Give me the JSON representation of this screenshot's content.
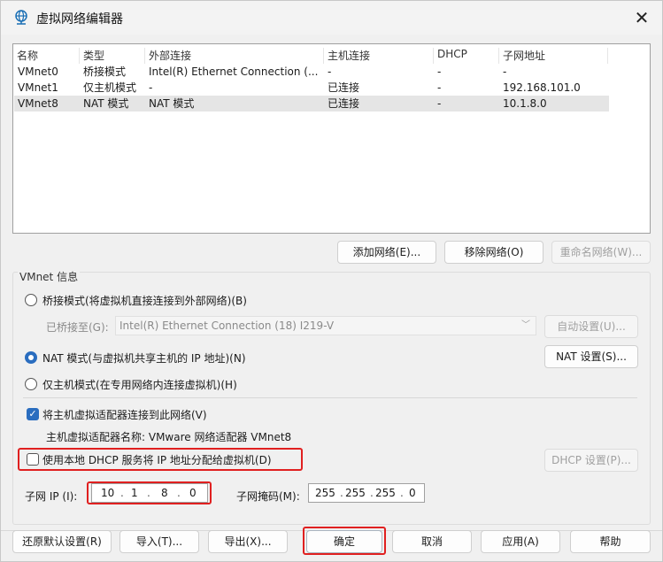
{
  "window": {
    "title": "虚拟网络编辑器",
    "close": "✕"
  },
  "table": {
    "headers": [
      "名称",
      "类型",
      "外部连接",
      "主机连接",
      "DHCP",
      "子网地址"
    ],
    "rows": [
      [
        "VMnet0",
        "桥接模式",
        "Intel(R) Ethernet Connection (...",
        "-",
        "-",
        "-"
      ],
      [
        "VMnet1",
        "仅主机模式",
        "-",
        "已连接",
        "-",
        "192.168.101.0"
      ],
      [
        "VMnet8",
        "NAT 模式",
        "NAT 模式",
        "已连接",
        "-",
        "10.1.8.0"
      ]
    ],
    "selected_row": 2
  },
  "list_buttons": {
    "add": "添加网络(E)...",
    "remove": "移除网络(O)",
    "rename": "重命名网络(W)..."
  },
  "vmnet_info": {
    "group_label": "VMnet 信息",
    "bridge_label": "桥接模式(将虚拟机直接连接到外部网络)(B)",
    "bridge_to_label": "已桥接至(G):",
    "bridge_to_value": "Intel(R) Ethernet Connection (18) I219-V",
    "auto_button": "自动设置(U)...",
    "nat_label": "NAT 模式(与虚拟机共享主机的 IP 地址)(N)",
    "nat_button": "NAT 设置(S)...",
    "hostonly_label": "仅主机模式(在专用网络内连接虚拟机)(H)",
    "connect_adapter_label": "将主机虚拟适配器连接到此网络(V)",
    "adapter_name_label": "主机虚拟适配器名称: VMware 网络适配器 VMnet8",
    "dhcp_label": "使用本地 DHCP 服务将 IP 地址分配给虚拟机(D)",
    "dhcp_button": "DHCP 设置(P)...",
    "subnet_ip_label": "子网 IP (I):",
    "subnet_ip": [
      "10",
      "1",
      "8",
      "0"
    ],
    "subnet_mask_label": "子网掩码(M):",
    "subnet_mask": [
      "255",
      "255",
      "255",
      "0"
    ],
    "selected_mode": "nat",
    "connect_adapter_checked": true,
    "dhcp_checked": false
  },
  "bottom_buttons": {
    "restore": "还原默认设置(R)",
    "import": "导入(T)...",
    "export": "导出(X)...",
    "ok": "确定",
    "cancel": "取消",
    "apply": "应用(A)",
    "help": "帮助"
  },
  "colors": {
    "accent": "#2a6dbf",
    "highlight": "#e02020",
    "selected_row": "#e5e5e5"
  },
  "icons": {
    "title": "globe-network-icon"
  }
}
